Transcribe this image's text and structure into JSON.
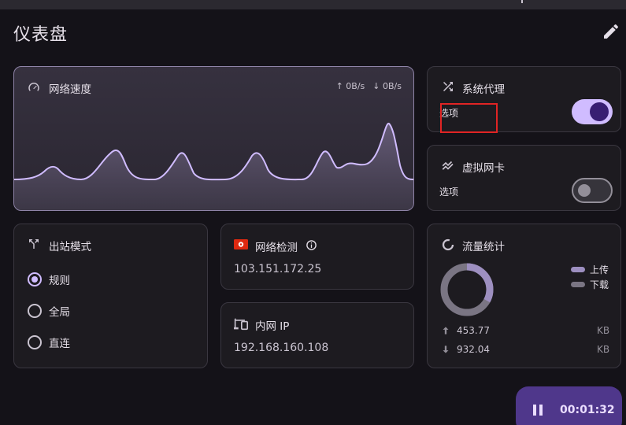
{
  "page": {
    "title": "仪表盘"
  },
  "speed": {
    "title": "网络速度",
    "upload": "↑ 0B/s",
    "download": "↓ 0B/s"
  },
  "system_proxy": {
    "title": "系统代理",
    "option_label": "选项",
    "enabled": true
  },
  "tun": {
    "title": "虚拟网卡",
    "option_label": "选项",
    "enabled": false
  },
  "outbound": {
    "title": "出站模式",
    "options": [
      "规则",
      "全局",
      "直连"
    ],
    "selected": "规则"
  },
  "network_check": {
    "title": "网络检测",
    "ip": "103.151.172.25"
  },
  "lan_ip": {
    "title": "内网 IP",
    "ip": "192.168.160.108"
  },
  "traffic": {
    "title": "流量统计",
    "legend_upload": "上传",
    "legend_download": "下载",
    "upload_value": "453.77",
    "download_value": "932.04",
    "unit": "KB",
    "upload_share": 0.33
  },
  "timer": {
    "elapsed": "00:01:32"
  },
  "colors": {
    "accent": "#d0bcff",
    "upload_legend": "#9d8fc0",
    "download_legend": "#7a7583",
    "hk_flag": "#de2910"
  },
  "icons": {
    "edit": "pencil-icon",
    "speed": "speedometer-icon",
    "proxy": "shuffle-icon",
    "tun": "trend-icon",
    "outbound": "fork-icon",
    "network_check": "hk-flag-icon",
    "info": "info-icon",
    "lan": "devices-icon",
    "traffic": "donut-icon",
    "pause": "pause-icon"
  }
}
